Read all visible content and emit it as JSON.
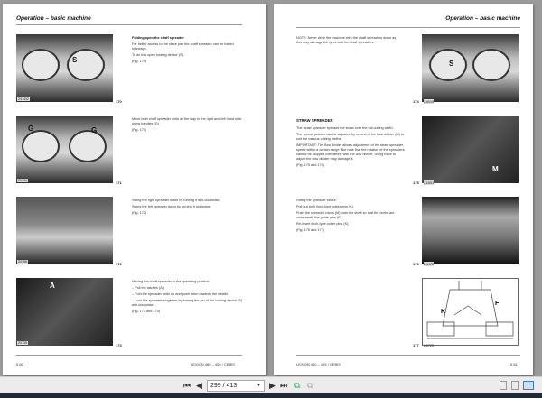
{
  "header": "Operation – basic machine",
  "left_page": {
    "sections": [
      {
        "title": "Folding open the chaff spreader",
        "paras": [
          "For better access to the sieve pan the chaff spreader can be folded sideways.",
          "To do this open locking device (S).",
          "(Fig. 170)"
        ],
        "fig": "170",
        "code": "Z41402",
        "labels": [
          "S"
        ]
      },
      {
        "paras": [
          "Move both chaff spreader units all the way to the right and left hand side, using handles (G).",
          "(Fig. 171)"
        ],
        "fig": "171",
        "code": "Z0155",
        "labels": [
          "G",
          "G"
        ]
      },
      {
        "paras": [
          "Swing the right spreader down by turning it anti-clockwise.",
          "Swing the left spreader down by turning it clockwise.",
          "(Fig. 172)"
        ],
        "fig": "172",
        "code": "Z0156",
        "labels": []
      },
      {
        "paras": [
          "Moving the chaff spreader to the operating position:",
          "–  Pull the latches (A).",
          "–  Fold the spreader units up and push them towards the middle.",
          "–  Lock the spreaders together by turning the pin of the locking device (S) anti-clockwise.",
          "(Fig. 173 and 174)"
        ],
        "fig": "173",
        "code": "Z0735",
        "labels": [
          "A"
        ]
      }
    ],
    "footer_left": "5.60",
    "footer_right": "LEXION 460 – 405 / CEBIS"
  },
  "right_page": {
    "sections": [
      {
        "paras": [
          "NOTE: Never drive the machine with the chaff spreaders down as this may damage the tyres and the chaff spreaders."
        ],
        "fig": "174",
        "code": "Z4019",
        "labels": [
          "S"
        ]
      },
      {
        "title": "STRAW SPREADER",
        "paras": [
          "The straw spreader spreads the straw over the full cutting width.",
          "The spread pattern can be adjusted by means of the flow divider (M) to suit the various cutting widths.",
          "IMPORTANT: The flow divider allows adjustment of the straw spreader speed within a certain range. But note that the rotation of the spreaders cannot be stopped completely with the flow divider. Using force to adjust the flow divider may damage it.",
          "(Fig. 175 and 176)"
        ],
        "fig": "175",
        "code": "Z1831",
        "labels": [
          "M"
        ]
      },
      {
        "paras": [
          "Fitting the spreader rotors:",
          "Pull out both linch-type cotter pins (K).",
          "Push the spreader rotors (M) onto the shaft so that the bores are underneath the guide pins (F).",
          "Re-insert linch-type cotter pins (K).",
          "(Fig. 176 and 177)"
        ],
        "fig": "176",
        "code": "Z4472",
        "labels": []
      },
      {
        "fig": "177",
        "code": "Z6720",
        "labels": [
          "K",
          "F"
        ]
      }
    ],
    "footer_left": "LEXION 460 – 405 / CEBIS",
    "footer_right": "5.61"
  },
  "toolbar": {
    "page_current": "299",
    "page_total": "413",
    "page_display": "299 / 413"
  }
}
